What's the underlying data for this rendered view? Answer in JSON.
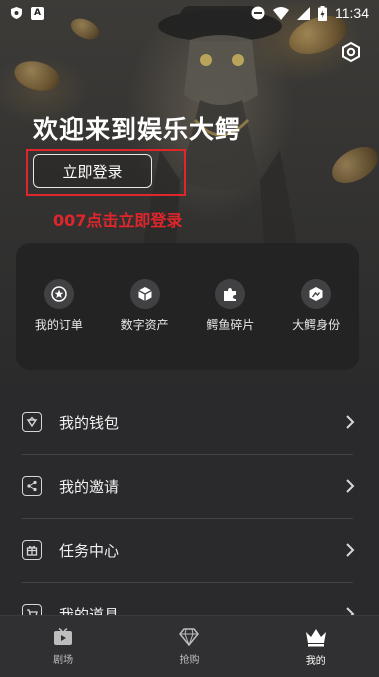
{
  "status_bar": {
    "time": "11:34",
    "left_icons": [
      "shield-notification-icon",
      "app-a-icon"
    ],
    "right_icons": [
      "do-not-disturb-icon",
      "wifi-icon",
      "signal-icon",
      "battery-icon"
    ]
  },
  "hero": {
    "welcome_text": "欢迎来到娱乐大鳄",
    "login_button": "立即登录",
    "annotation": "007点击立即登录",
    "settings_icon": "settings-hexagon-icon"
  },
  "quick_actions": [
    {
      "label": "我的订单",
      "icon": "star-icon"
    },
    {
      "label": "数字资产",
      "icon": "cube-icon"
    },
    {
      "label": "鳄鱼碎片",
      "icon": "puzzle-icon"
    },
    {
      "label": "大鳄身份",
      "icon": "id-card-icon"
    }
  ],
  "menu": [
    {
      "label": "我的钱包",
      "icon": "wallet-icon"
    },
    {
      "label": "我的邀请",
      "icon": "share-icon"
    },
    {
      "label": "任务中心",
      "icon": "gift-icon"
    },
    {
      "label": "我的道具",
      "icon": "cart-icon"
    }
  ],
  "bottom_nav": [
    {
      "label": "剧场",
      "icon": "theater-play-icon",
      "active": false
    },
    {
      "label": "抢购",
      "icon": "diamond-icon",
      "active": false
    },
    {
      "label": "我的",
      "icon": "crown-icon",
      "active": true
    }
  ],
  "colors": {
    "annotation_red": "#e0252b",
    "background": "#2a2a2c",
    "panel": "#232324"
  }
}
